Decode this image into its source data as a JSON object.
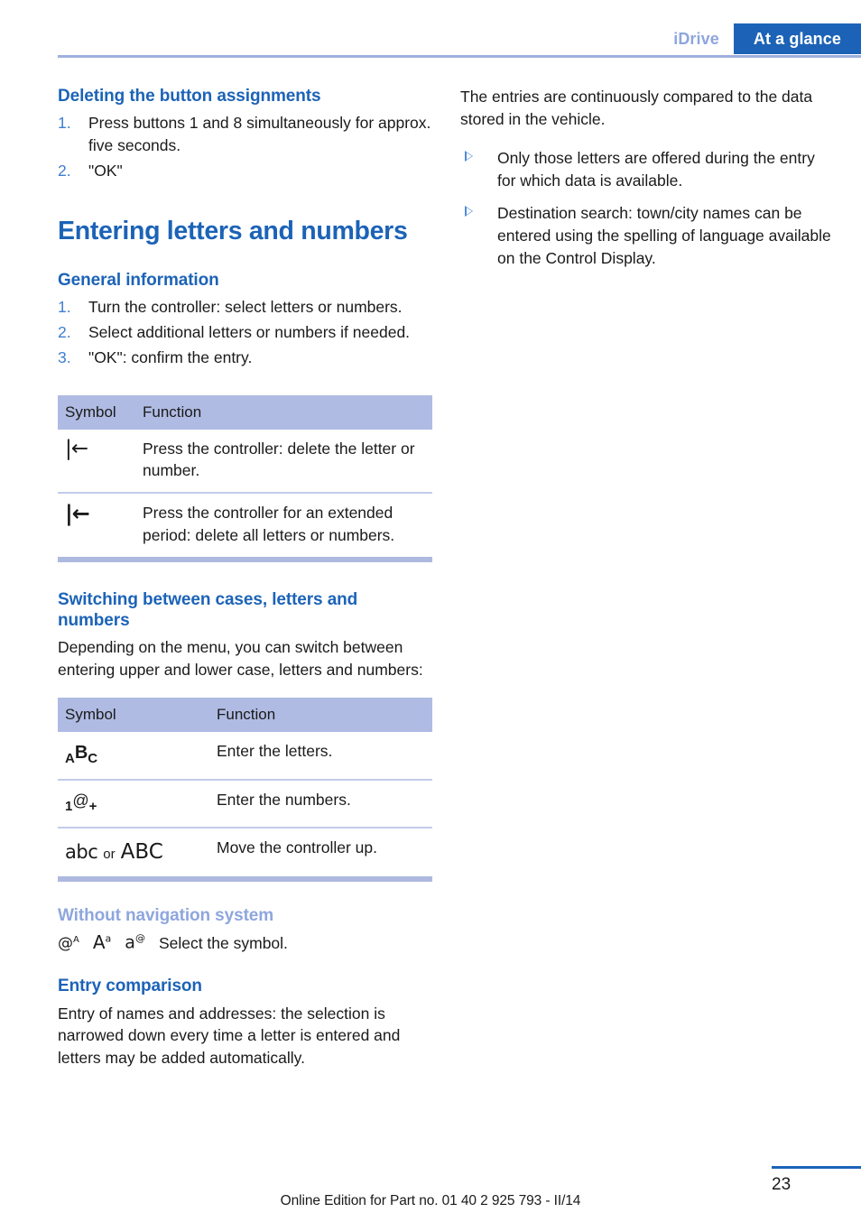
{
  "header": {
    "tab_inactive": "iDrive",
    "tab_active": "At a glance"
  },
  "left_column": {
    "section_deleting": {
      "heading": "Deleting the button assignments",
      "steps": [
        {
          "num": "1.",
          "text": "Press buttons 1 and 8 simultaneously for approx. five seconds."
        },
        {
          "num": "2.",
          "text": "\"OK\""
        }
      ]
    },
    "main_heading": "Entering letters and numbers",
    "section_general": {
      "heading": "General information",
      "steps": [
        {
          "num": "1.",
          "text": "Turn the controller: select letters or numbers."
        },
        {
          "num": "2.",
          "text": "Select additional letters or numbers if needed."
        },
        {
          "num": "3.",
          "text": "\"OK\": confirm the entry."
        }
      ]
    },
    "table_delete": {
      "columns": [
        "Symbol",
        "Function"
      ],
      "rows": [
        {
          "symbol": "|←",
          "symbol_name": "delete-character-icon",
          "function": "Press the controller: delete the letter or number."
        },
        {
          "symbol": "|←",
          "symbol_name": "delete-all-icon",
          "function": "Press the controller for an extended period: delete all letters or numbers."
        }
      ]
    },
    "section_switching": {
      "heading": "Switching between cases, letters and numbers",
      "body": "Depending on the menu, you can switch between entering upper and lower case, letters and numbers:"
    },
    "table_switching": {
      "columns": [
        "Symbol",
        "Function"
      ],
      "rows": [
        {
          "symbol_name": "letters-mode-icon",
          "symbol_parts": {
            "a": "A",
            "b": "B",
            "c": "C"
          },
          "function": "Enter the letters."
        },
        {
          "symbol_name": "numbers-mode-icon",
          "symbol_parts": {
            "one": "1",
            "at": "@",
            "plus": "+"
          },
          "function": "Enter the numbers."
        },
        {
          "symbol_name": "case-toggle-icon",
          "symbol_parts": {
            "lower": "abc",
            "or": "or",
            "upper": "ABC"
          },
          "function": "Move the controller up."
        }
      ]
    },
    "section_without_nav": {
      "heading": "Without navigation system",
      "symbols": [
        {
          "name": "at-upper-a-icon",
          "base": "@",
          "sup": "A"
        },
        {
          "name": "upper-a-lower-a-icon",
          "base": "A",
          "sup": "a"
        },
        {
          "name": "lower-a-at-icon",
          "base": "a",
          "sup": "@"
        }
      ],
      "text": "Select the symbol."
    },
    "section_entry_comparison": {
      "heading": "Entry comparison",
      "body": "Entry of names and addresses: the selection is narrowed down every time a letter is entered and letters may be added automatically."
    }
  },
  "right_column": {
    "intro": "The entries are continuously compared to the data stored in the vehicle.",
    "bullets": [
      "Only those letters are offered during the entry for which data is available.",
      "Destination search: town/city names can be entered using the spelling of language available on the Control Display."
    ]
  },
  "footer": {
    "note": "Online Edition for Part no. 01 40 2 925 793 - II/14",
    "page_number": "23"
  },
  "colors": {
    "brand_blue": "#1c63b7",
    "muted_blue": "#8ea6de",
    "table_header_bg": "#afbbe2",
    "table_border": "#c3ccea",
    "rule_blue": "#9fb0dd"
  }
}
